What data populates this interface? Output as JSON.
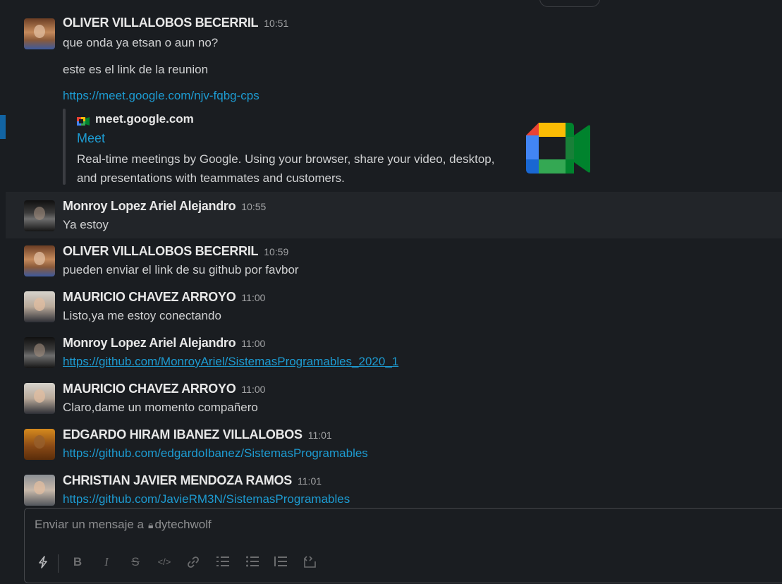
{
  "messages": [
    {
      "avatar": "oliver",
      "sender": "OLIVER VILLALOBOS BECERRIL",
      "time": "10:51",
      "lines": [
        "que onda ya etsan o aun no?",
        "este es el link de la reunion"
      ],
      "link": "https://meet.google.com/njv-fqbg-cps"
    },
    {
      "avatar": "monroy",
      "sender": "Monroy Lopez Ariel Alejandro",
      "time": "10:55",
      "text": "Ya estoy"
    },
    {
      "avatar": "oliver",
      "sender": "OLIVER VILLALOBOS BECERRIL",
      "time": "10:59",
      "text": "pueden enviar el link de su github por favbor"
    },
    {
      "avatar": "mauricio",
      "sender": "MAURICIO CHAVEZ ARROYO",
      "time": "11:00",
      "text": "Listo,ya me estoy conectando"
    },
    {
      "avatar": "monroy",
      "sender": "Monroy Lopez Ariel Alejandro",
      "time": "11:00",
      "link": "https://github.com/MonroyAriel/SistemasProgramables_2020_1"
    },
    {
      "avatar": "mauricio",
      "sender": "MAURICIO CHAVEZ ARROYO",
      "time": "11:00",
      "text": "Claro,dame un momento compañero"
    },
    {
      "avatar": "edgardo",
      "sender": "EDGARDO HIRAM IBANEZ VILLALOBOS",
      "time": "11:01",
      "link": "https://github.com/edgardoIbanez/SistemasProgramables"
    },
    {
      "avatar": "christian",
      "sender": "CHRISTIAN JAVIER MENDOZA RAMOS",
      "time": "11:01",
      "link": "https://github.com/JavieRM3N/SistemasProgramables"
    }
  ],
  "unfurl": {
    "site": "meet.google.com",
    "title": "Meet",
    "description": "Real-time meetings by Google. Using your browser, share your video, desktop, and presentations with teammates and customers."
  },
  "composer": {
    "placeholder_prefix": "Enviar un mensaje a",
    "channel": "dytechwolf",
    "toolbar": [
      "shortcuts-icon",
      "bold-icon",
      "italic-icon",
      "strikethrough-icon",
      "code-icon",
      "link-icon",
      "ordered-list-icon",
      "bulleted-list-icon",
      "blockquote-icon",
      "code-block-icon"
    ]
  },
  "colors": {
    "background": "#1a1d21",
    "link": "#1d9bd1",
    "accent": "#1264a3"
  }
}
